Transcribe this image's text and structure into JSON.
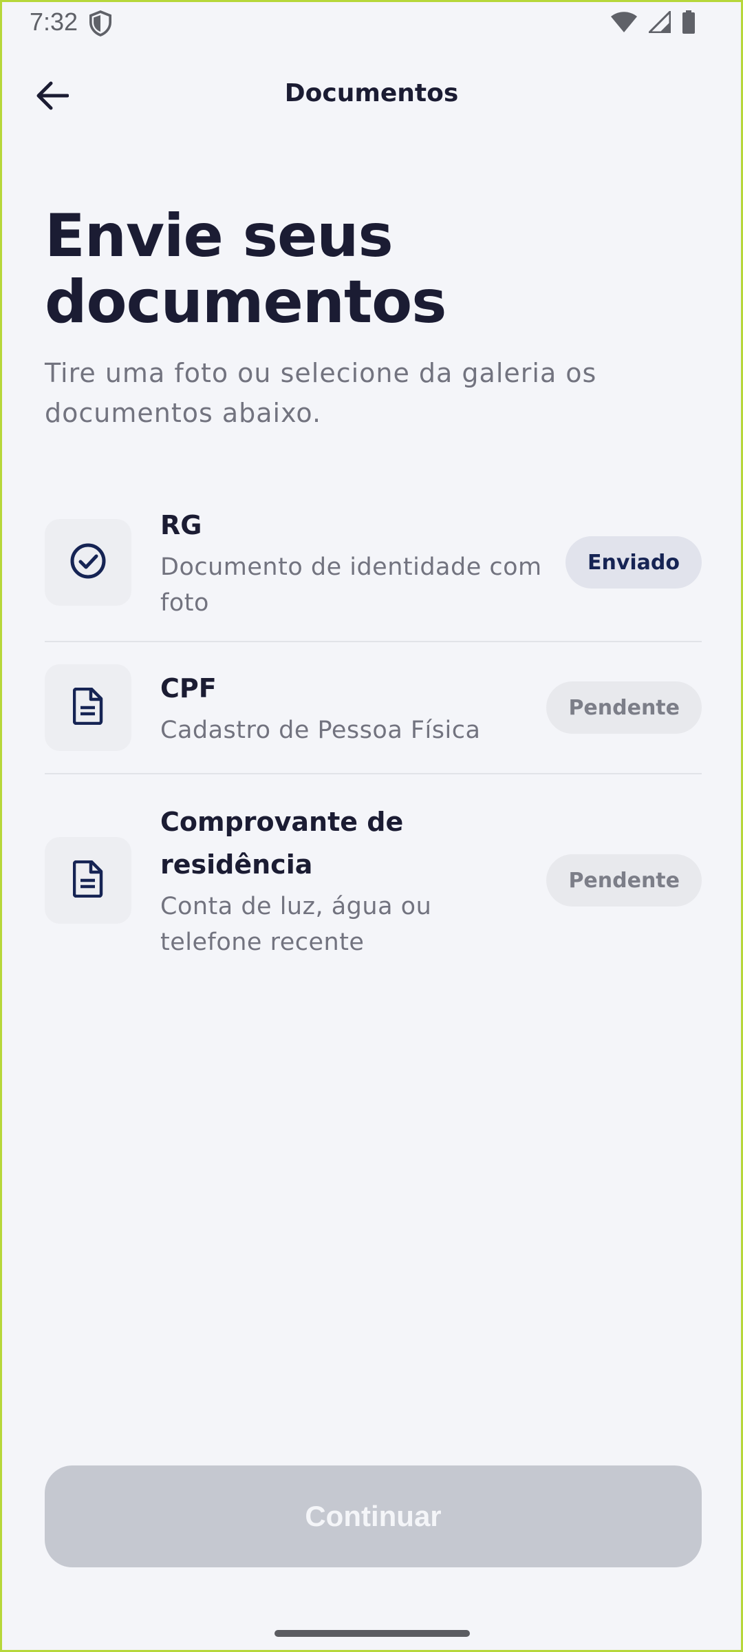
{
  "status_bar": {
    "time": "7:32",
    "icons": [
      "shield-icon",
      "wifi-icon",
      "signal-icon",
      "battery-icon"
    ]
  },
  "app_bar": {
    "title": "Documentos",
    "back_icon": "arrow-left-icon"
  },
  "heading": {
    "line1": "Envie seus",
    "line2": "documentos",
    "subtitle": "Tire uma foto ou selecione da galeria os documentos abaixo."
  },
  "documents": [
    {
      "name": "RG",
      "description": "Documento de identidade com foto",
      "status": "Enviado",
      "icon": "check-circle-icon"
    },
    {
      "name": "CPF",
      "description": "Cadastro de Pessoa Física",
      "status": "Pendente",
      "icon": "document-icon"
    },
    {
      "name": "Comprovante de residência",
      "description": "Conta de luz, água ou telefone recente",
      "status": "Pendente",
      "icon": "document-icon"
    }
  ],
  "continue_button": {
    "label": "Continuar",
    "enabled": false
  },
  "colors": {
    "background": "#f4f5f9",
    "primary_text": "#1b1c33",
    "secondary_text": "#72737f",
    "icon_navy": "#162454",
    "button_disabled": "#c5c8d0"
  }
}
